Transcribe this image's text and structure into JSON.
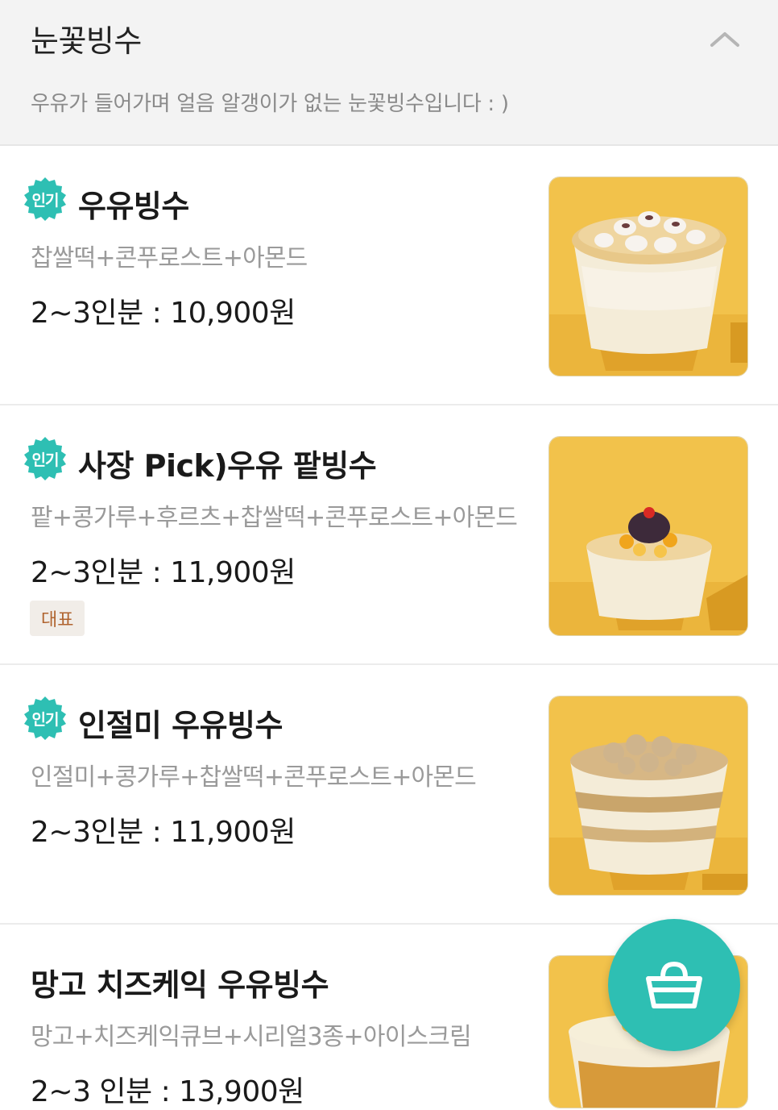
{
  "section": {
    "title": "눈꽃빙수",
    "description": "우유가 들어가며 얼음 알갱이가 없는 눈꽃빙수입니다 : )",
    "collapse_icon": "chevron-up-icon"
  },
  "badge_label": "인기",
  "colors": {
    "accent": "#2ebfb3",
    "badge": "#2ebfb3",
    "tag_bg": "#f1ede8",
    "tag_text": "#b0642f",
    "photo_bg": "#f2c24b"
  },
  "items": [
    {
      "name": "우유빙수",
      "description": "찹쌀떡+콘푸로스트+아몬드",
      "price": "2~3인분 : 10,900원",
      "popular": true,
      "tag": ""
    },
    {
      "name": "사장 Pick)우유 팥빙수",
      "description": "팥+콩가루+후르츠+찹쌀떡+콘푸로스트+아몬드",
      "price": "2~3인분 : 11,900원",
      "popular": true,
      "tag": "대표"
    },
    {
      "name": "인절미 우유빙수",
      "description": "인절미+콩가루+찹쌀떡+콘푸로스트+아몬드",
      "price": "2~3인분 : 11,900원",
      "popular": true,
      "tag": ""
    },
    {
      "name": "망고 치즈케익 우유빙수",
      "description": "망고+치즈케익큐브+시리얼3종+아이스크림",
      "price": "2~3 인분 : 13,900원",
      "popular": false,
      "tag": ""
    }
  ],
  "cart": {
    "icon": "shopping-basket-icon"
  }
}
